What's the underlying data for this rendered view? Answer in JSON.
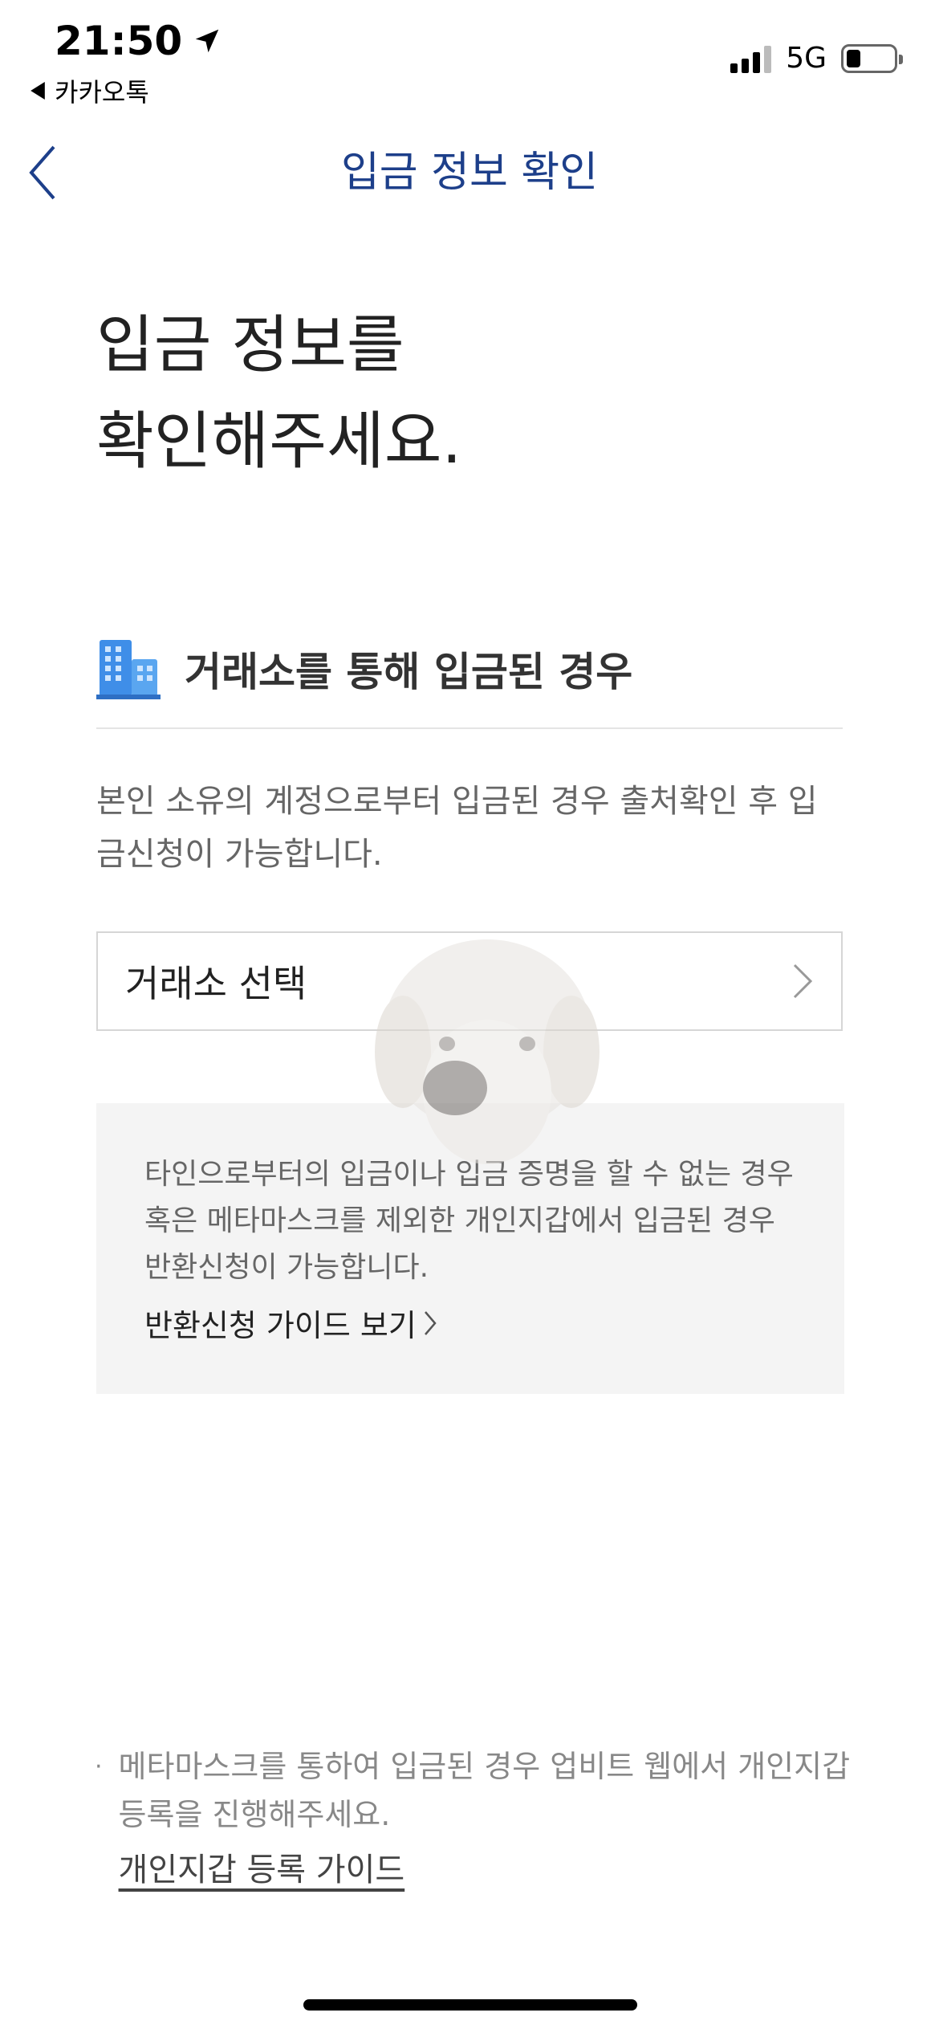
{
  "status_bar": {
    "time": "21:50",
    "back_app": "카카오톡",
    "network": "5G",
    "battery_level": 0.3,
    "icons": [
      "location-arrow-icon",
      "signal-icon",
      "battery-icon"
    ]
  },
  "header": {
    "title": "입금 정보 확인",
    "back_icon": "chevron-left-icon"
  },
  "heading": {
    "line1": "입금 정보를",
    "line2": "확인해주세요."
  },
  "exchange_section": {
    "icon": "building-icon",
    "title": "거래소를 통해 입금된 경우",
    "description": "본인 소유의 계정으로부터 입금된 경우 출처확인 후 입금신청이 가능합니다.",
    "select_label": "거래소 선택"
  },
  "return_box": {
    "text": "타인으로부터의 입금이나 입금 증명을 할 수 없는 경우 혹은 메타마스크를 제외한 개인지갑에서 입금된 경우 반환신청이 가능합니다.",
    "link_label": "반환신청 가이드 보기"
  },
  "footer_note": {
    "bullet": "·",
    "text": "메타마스크를 통하여 입금된 경우 업비트 웹에서 개인지갑 등록을 진행해주세요.",
    "link_label": "개인지갑 등록 가이드"
  },
  "colors": {
    "header_title": "#1d3f8a",
    "accent_blue": "#3a7bd5",
    "gray_box": "#f4f4f4"
  }
}
